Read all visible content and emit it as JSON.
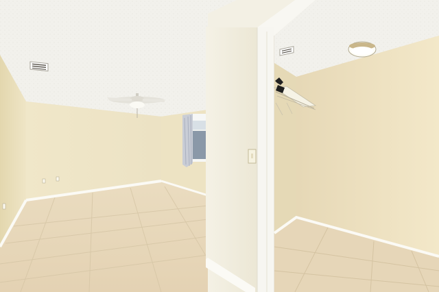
{
  "scene": {
    "description_tag": "empty-room-photo",
    "colors": {
      "ceiling": "#f1f0ec",
      "wall_warm": "#efe6c9",
      "wall_left": "#e6dcba",
      "wall_shadow": "#e2d8b6",
      "floor": "#e8d9bd",
      "floor_line": "#d4c3a2",
      "trim": "#fbfaf5",
      "door_frame": "#f7f6f1",
      "partition": "#f1eee2"
    },
    "objects": [
      "ceiling-fan-icon",
      "air-vent-icon",
      "window",
      "curtain",
      "closet-shelf",
      "rod-hanger",
      "ceiling-light",
      "light-switch",
      "wall-outlet"
    ]
  }
}
